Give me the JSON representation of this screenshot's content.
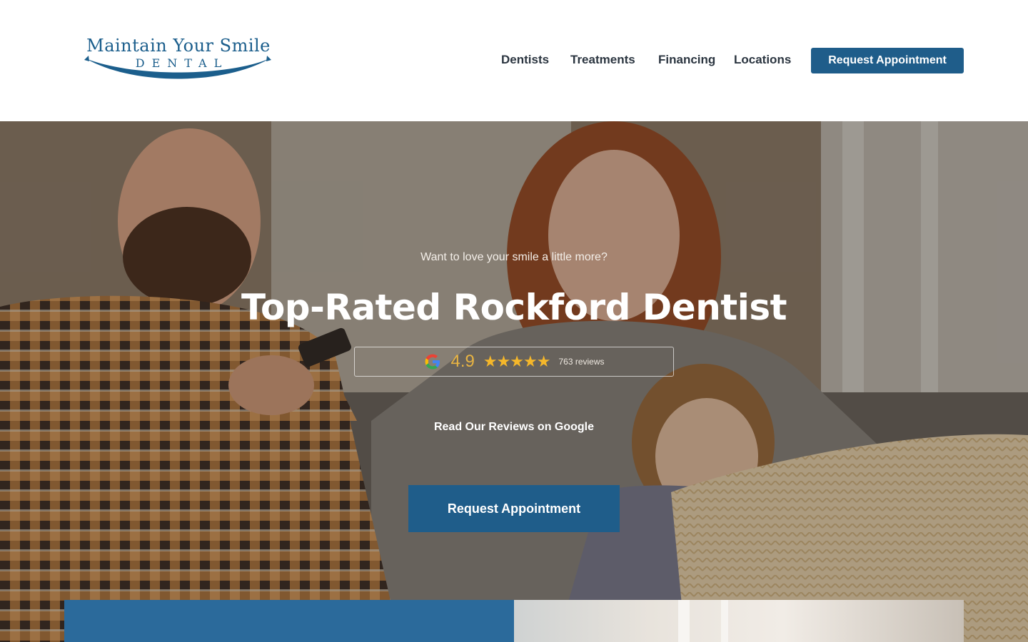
{
  "header": {
    "logo": {
      "line1": "Maintain Your Smile",
      "line2": "DENTAL"
    },
    "nav": [
      {
        "label": "Dentists"
      },
      {
        "label": "Treatments"
      },
      {
        "label": "Financing"
      },
      {
        "label": "Locations"
      }
    ],
    "cta_label": "Request Appointment"
  },
  "hero": {
    "kicker": "Want to love your smile a little more?",
    "headline": "Top-Rated Rockford Dentist",
    "rating": {
      "source_icon": "google-icon",
      "score": "4.9",
      "stars": "★★★★★",
      "stars_value": 5,
      "reviews": "763 reviews"
    },
    "reviews_link": "Read Our Reviews on Google",
    "cta_label": "Request Appointment"
  },
  "colors": {
    "brand_blue": "#1f5d8a",
    "star_gold": "#f5b72a",
    "panel_blue": "#2b6a9b"
  }
}
